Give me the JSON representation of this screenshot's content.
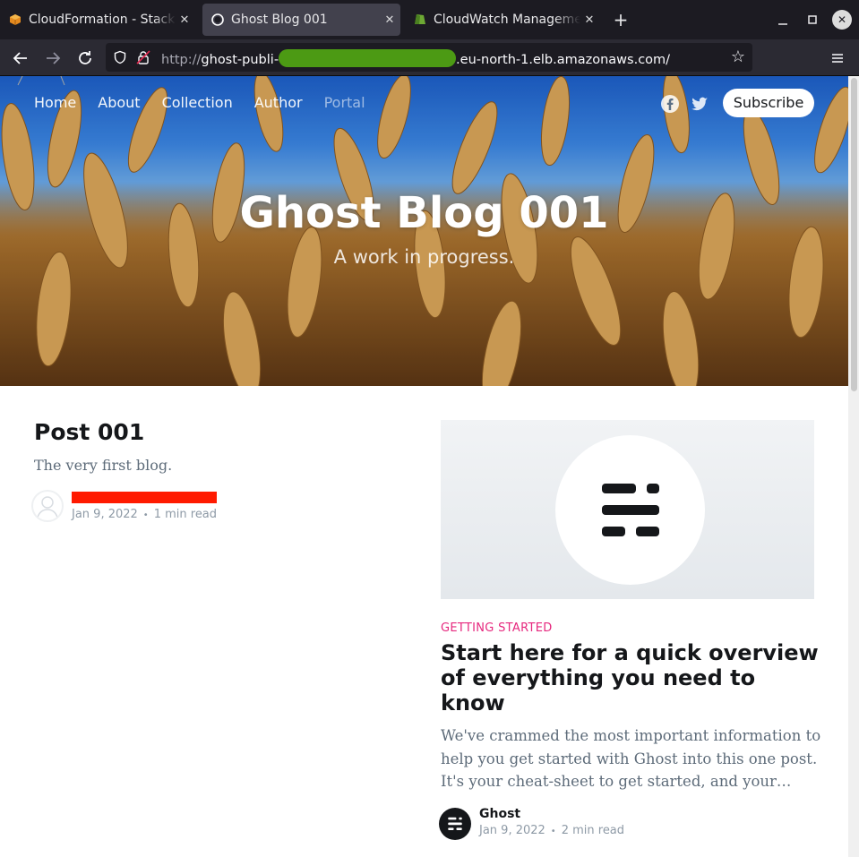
{
  "browser": {
    "tabs": [
      {
        "title": "CloudFormation - Stack g",
        "icon": "aws-cube-icon",
        "active": false
      },
      {
        "title": "Ghost Blog 001",
        "icon": "ghost-logo-icon",
        "active": true
      },
      {
        "title": "CloudWatch Managemen",
        "icon": "cloudwatch-icon",
        "active": false
      }
    ],
    "new_tab": "+",
    "url": {
      "scheme": "http://",
      "host_prefix": "ghost-publi-",
      "host_suffix": ".eu-north-1.elb.amazonaws.com/"
    }
  },
  "site": {
    "nav": [
      "Home",
      "About",
      "Collection",
      "Author",
      "Portal"
    ],
    "subscribe_label": "Subscribe",
    "title": "Ghost Blog 001",
    "description": "A work in progress."
  },
  "posts": [
    {
      "title": "Post 001",
      "excerpt": "The very first blog.",
      "date": "Jan 9, 2022",
      "reading_time": "1 min read"
    },
    {
      "tag": "GETTING STARTED",
      "title": "Start here for a quick overview of everything you need to know",
      "excerpt": "We've crammed the most important information to help you get started with Ghost into this one post. It's your cheat-sheet to get started, and your…",
      "author": "Ghost",
      "date": "Jan 9, 2022",
      "reading_time": "2 min read"
    }
  ],
  "colors": {
    "tag_accent": "#e6287e",
    "url_redaction": "#4c9a14",
    "author_redaction": "#ff1a00"
  }
}
